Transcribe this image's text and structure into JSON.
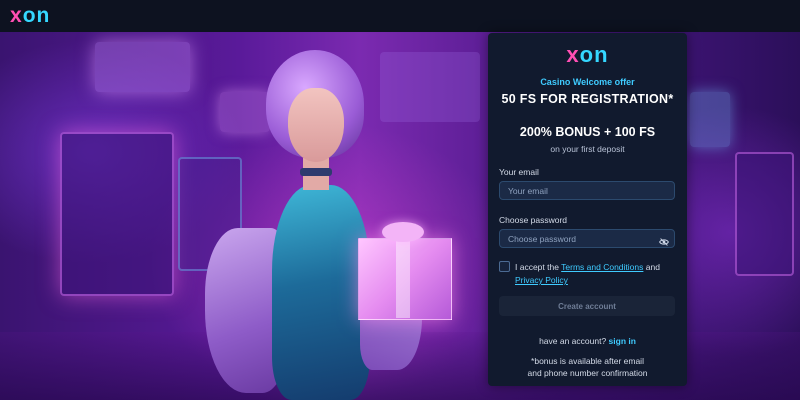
{
  "header": {
    "logo_part1": "x",
    "logo_part2": "on"
  },
  "panel": {
    "logo_part1": "x",
    "logo_part2": "on",
    "offer_title": "Casino Welcome offer",
    "offer_fs": "50 FS FOR REGISTRATION*",
    "offer_bonus": "200% BONUS + 100 FS",
    "offer_sub": "on your first deposit",
    "email_label": "Your email",
    "email_placeholder": "Your email",
    "email_value": "",
    "password_label": "Choose password",
    "password_placeholder": "Choose password",
    "password_value": "",
    "terms_prefix": "I accept the",
    "terms_link": "Terms and Conditions",
    "terms_and": "and",
    "privacy_link": "Privacy Policy",
    "create_button": "Create account",
    "have_account_text": "have an account?",
    "sign_in_link": "sign in",
    "note_line1": "*bonus is available after email",
    "note_line2": "and phone number confirmation"
  },
  "colors": {
    "accent_cyan": "#3fcbff",
    "logo_pink": "#ff4fb4",
    "logo_cyan": "#35d7ff",
    "panel_bg": "#111a2e"
  },
  "icons": {
    "password_toggle": "eye-slash-icon"
  }
}
